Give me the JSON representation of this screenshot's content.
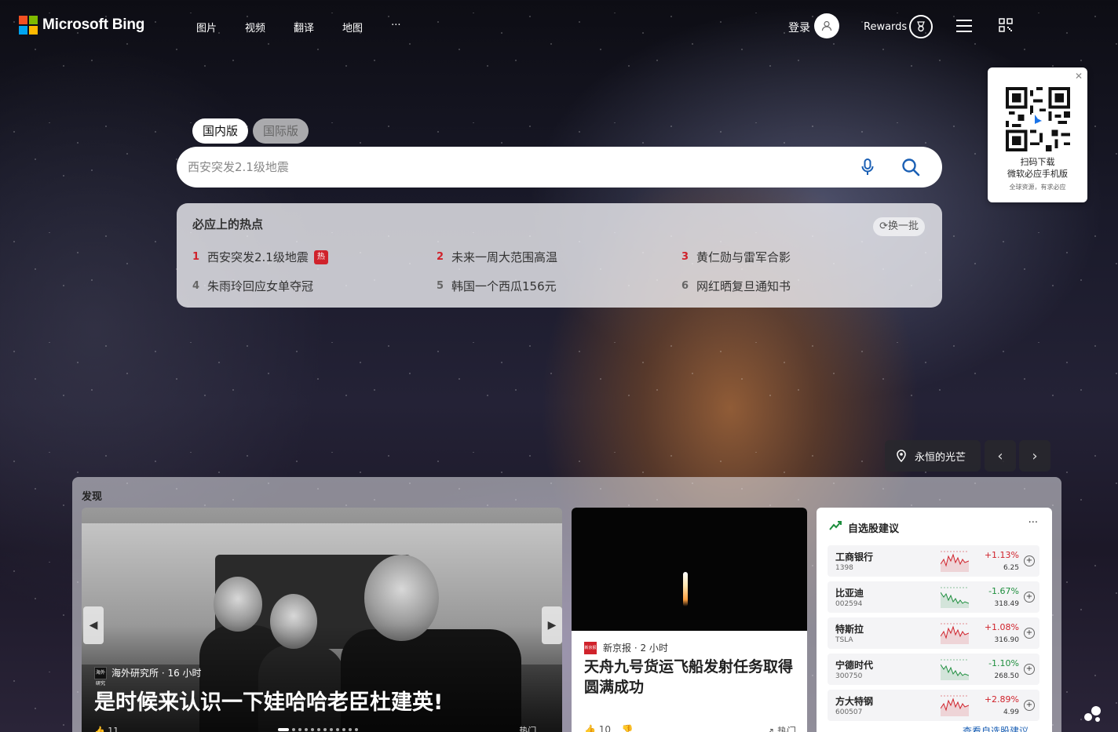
{
  "brand": {
    "name": "Microsoft Bing",
    "colors": [
      "#f25022",
      "#7fba00",
      "#00a4ef",
      "#ffb900"
    ]
  },
  "nav": [
    "图片",
    "视频",
    "翻译",
    "地图",
    "···"
  ],
  "header": {
    "login": "登录",
    "rewards": "Rewards"
  },
  "qr_popup": {
    "line1": "扫码下载",
    "line2": "微软必应手机版",
    "line3": "全球资源，有求必应"
  },
  "tabs": [
    "国内版",
    "国际版"
  ],
  "search": {
    "placeholder": "西安突发2.1级地震"
  },
  "hot": {
    "title": "必应上的热点",
    "refresh": "换一批",
    "badge": "热",
    "items": [
      {
        "n": "1",
        "text": "西安突发2.1级地震"
      },
      {
        "n": "2",
        "text": "未来一周大范围高温"
      },
      {
        "n": "3",
        "text": "黄仁勋与雷军合影"
      },
      {
        "n": "4",
        "text": "朱雨玲回应女单夺冠"
      },
      {
        "n": "5",
        "text": "韩国一个西瓜156元"
      },
      {
        "n": "6",
        "text": "网红晒复旦通知书"
      }
    ]
  },
  "image_caption": "永恒的光芒",
  "feed": {
    "title": "发现",
    "card1": {
      "source": "海外研究所 · 16 小时",
      "source_icon": "海外研究所",
      "headline": "是时候来认识一下娃哈哈老臣杜建英!",
      "likes": "11",
      "tag": "热门"
    },
    "card2": {
      "source": "新京报 · 2 小时",
      "source_icon": "新京报",
      "headline": "天舟九号货运飞船发射任务取得圆满成功",
      "likes": "10",
      "tag": "热门"
    },
    "card3": {
      "title": "自选股建议",
      "more": "···",
      "stocks": [
        {
          "name": "工商银行",
          "code": "1398",
          "pct": "+1.13%",
          "price": "6.25",
          "up": true
        },
        {
          "name": "比亚迪",
          "code": "002594",
          "pct": "-1.67%",
          "price": "318.49",
          "up": false
        },
        {
          "name": "特斯拉",
          "code": "TSLA",
          "pct": "+1.08%",
          "price": "316.90",
          "up": true
        },
        {
          "name": "宁德时代",
          "code": "300750",
          "pct": "-1.10%",
          "price": "268.50",
          "up": false
        },
        {
          "name": "方大特钢",
          "code": "600507",
          "pct": "+2.89%",
          "price": "4.99",
          "up": true
        }
      ],
      "link": "查看自选股建议"
    }
  }
}
